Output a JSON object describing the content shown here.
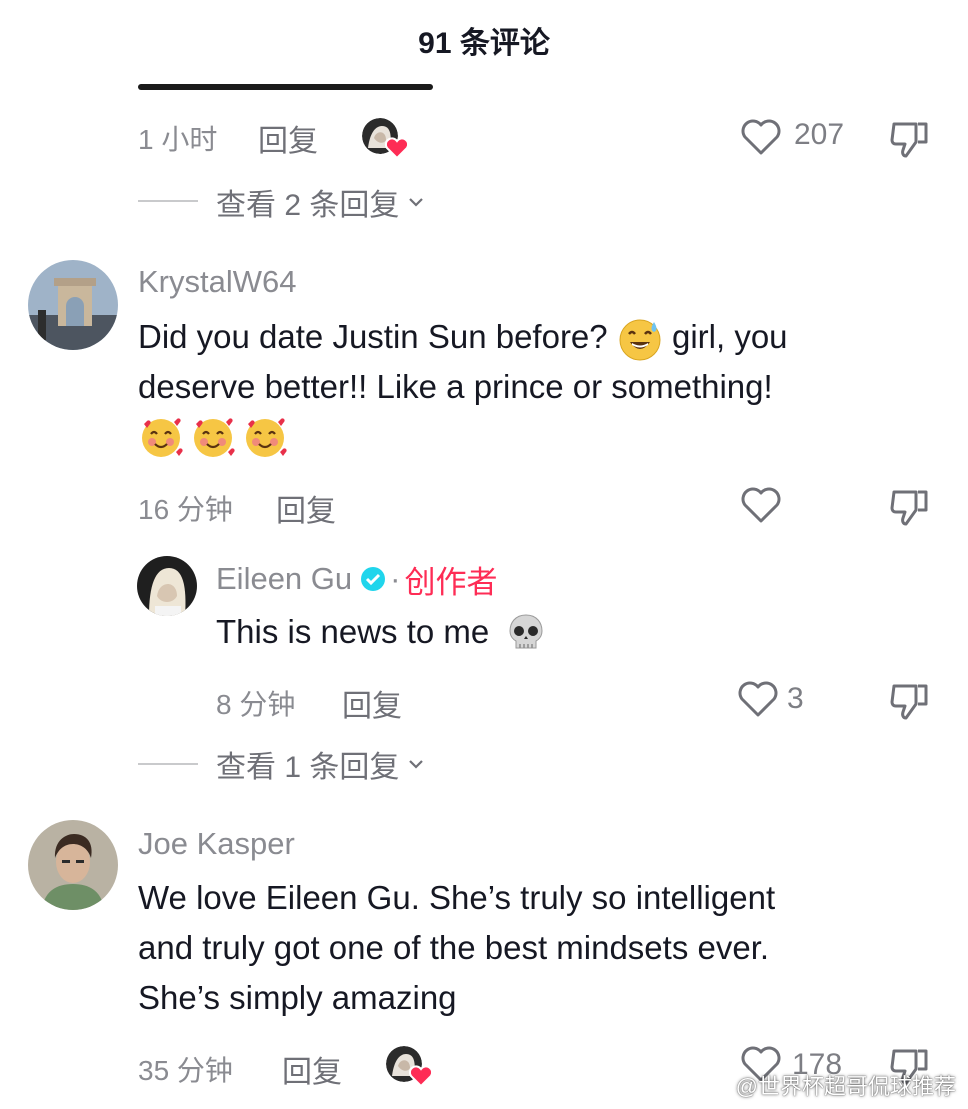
{
  "header": {
    "title": "91 条评论"
  },
  "comment0": {
    "time": "1 小时",
    "reply_label": "回复",
    "like_count": "207",
    "view_replies": "查看 2 条回复"
  },
  "comment1": {
    "username": "KrystalW64",
    "text_part1": "Did you date Justin Sun before?",
    "text_part2": "girl, you",
    "text_line2": "deserve better!! Like a prince or something!",
    "time": "16 分钟",
    "reply_label": "回复"
  },
  "reply1": {
    "username": "Eileen Gu",
    "separator": "·",
    "creator_badge": "创作者",
    "text": "This is news to me",
    "time": "8 分钟",
    "reply_label": "回复",
    "like_count": "3",
    "view_replies": "查看 1 条回复"
  },
  "comment2": {
    "username": "Joe Kasper",
    "text_line1": "We love Eileen Gu. She’s truly so intelligent",
    "text_line2": "and truly got one of the best mindsets ever.",
    "text_line3": "She’s simply amazing",
    "time": "35 分钟",
    "reply_label": "回复",
    "like_count": "178"
  },
  "watermark": "@世界杯超哥侃球推荐",
  "icons": {
    "heart": "heart-outline-icon",
    "dislike": "thumbs-down-icon",
    "chevron": "chevron-down-icon",
    "verified": "verified-badge-icon"
  },
  "colors": {
    "accent": "#fe2c55",
    "verified": "#20d5ec",
    "text": "#161823",
    "muted": "#8a8b91"
  }
}
